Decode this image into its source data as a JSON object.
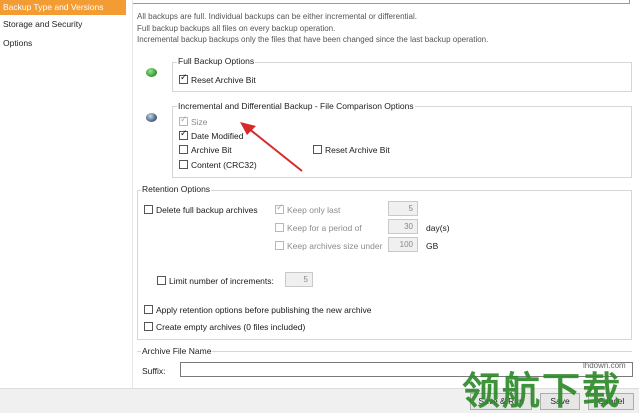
{
  "nav": {
    "items": [
      {
        "label": "Backup Type and Versions",
        "active": true
      },
      {
        "label": "Storage and Security",
        "active": false
      },
      {
        "label": "Options",
        "active": false
      }
    ]
  },
  "info": {
    "line1": "All backups are full. Individual backups can be either incremental or differential.",
    "line2": "Full backup backups all files on every backup operation.",
    "line3": "Incremental backup backups only the files that have been changed since the last backup operation."
  },
  "full_backup": {
    "title": "Full Backup Options",
    "reset_archive_bit": {
      "label": "Reset Archive Bit",
      "checked": true
    }
  },
  "incremental": {
    "title": "Incremental and Differential Backup - File Comparison Options",
    "size": {
      "label": "Size",
      "checked": true,
      "disabled": true
    },
    "date_modified": {
      "label": "Date Modified",
      "checked": true
    },
    "archive_bit": {
      "label": "Archive Bit",
      "checked": false
    },
    "reset_archive_bit": {
      "label": "Reset Archive Bit",
      "checked": false
    },
    "content": {
      "label": "Content (CRC32)",
      "checked": false
    }
  },
  "retention": {
    "title": "Retention Options",
    "delete_full": {
      "label": "Delete full backup archives",
      "checked": false
    },
    "keep_only_last": {
      "label": "Keep only last",
      "checked": true,
      "value": "5"
    },
    "keep_period": {
      "label": "Keep for a period of",
      "checked": false,
      "value": "30",
      "unit": "day(s)"
    },
    "keep_size": {
      "label": "Keep archives size under",
      "checked": false,
      "value": "100",
      "unit": "GB"
    },
    "limit_increments": {
      "label": "Limit number of increments:",
      "checked": false,
      "value": "5"
    },
    "apply_before_publishing": {
      "label": "Apply retention options before publishing the new archive",
      "checked": false
    },
    "create_empty": {
      "label": "Create empty archives (0 files included)",
      "checked": false
    }
  },
  "archive_file_name": {
    "title": "Archive File Name",
    "suffix_label": "Suffix:",
    "suffix_value": ""
  },
  "buttons": {
    "save_run": "Save & Run",
    "save": "Save",
    "cancel": "Cancel"
  },
  "watermark": {
    "text": "领航下载",
    "url": "lhdown.com"
  },
  "colors": {
    "accent": "#f39c33",
    "arrow": "#d62b2b",
    "full_icon": "#3aa13a",
    "incremental_icon": "#4a6a8a",
    "watermark": "#2f8a2b"
  }
}
